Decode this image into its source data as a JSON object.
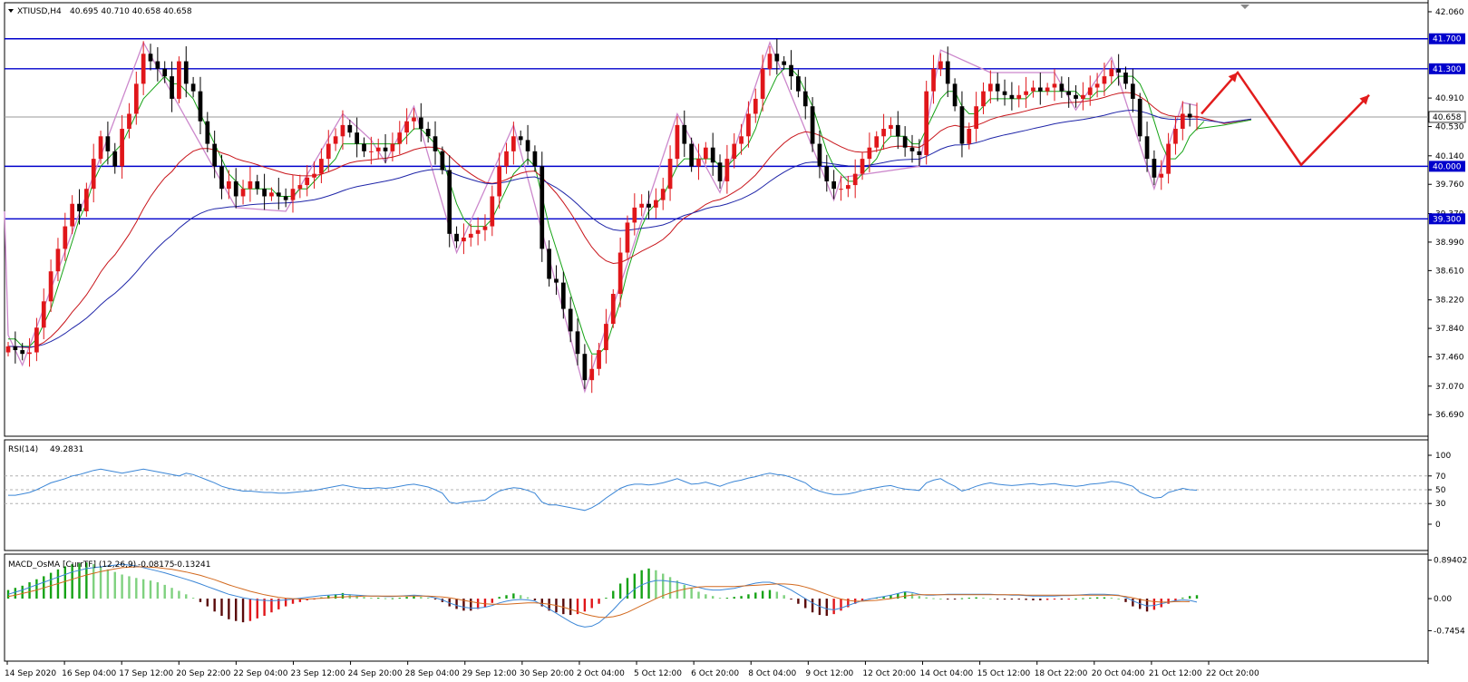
{
  "window": {
    "title": "XTIUSD,H4",
    "ohlc": "40.695 40.710 40.658 40.658"
  },
  "colors": {
    "bull": "#e0161a",
    "bear": "#000000",
    "level_line": "#0000cc",
    "ma_fast": "#16a316",
    "ma_mid": "#c8141a",
    "ma_slow": "#1f25a8",
    "zigzag": "#cc88cc",
    "forecast": "#e21c1c",
    "rsi": "#3b86d6",
    "macd_line": "#3b86d6",
    "signal_line": "#d2691e",
    "hist_up_strong": "#16a316",
    "hist_up_weak": "#7fd17f",
    "hist_down_strong": "#5a0b0b",
    "hist_down_weak": "#e0161a"
  },
  "chart_data": [
    {
      "type": "candlestick",
      "symbol": "XTIUSD",
      "timeframe": "H4",
      "ylim": [
        36.62,
        42.12
      ],
      "y_ticks": [
        "42.060",
        "41.700",
        "41.300",
        "40.910",
        "40.658",
        "40.530",
        "40.140",
        "40.000",
        "39.760",
        "39.370",
        "39.300",
        "38.990",
        "38.610",
        "38.220",
        "37.840",
        "37.460",
        "37.070",
        "36.690"
      ],
      "x_tick_labels": [
        "14 Sep 2020",
        "16 Sep 04:00",
        "17 Sep 12:00",
        "20 Sep 22:00",
        "22 Sep 04:00",
        "23 Sep 12:00",
        "24 Sep 20:00",
        "28 Sep 04:00",
        "29 Sep 12:00",
        "30 Sep 20:00",
        "2 Oct 04:00",
        "5 Oct 12:00",
        "6 Oct 20:00",
        "8 Oct 04:00",
        "9 Oct 12:00",
        "12 Oct 20:00",
        "14 Oct 04:00",
        "15 Oct 12:00",
        "18 Oct 22:00",
        "20 Oct 04:00",
        "21 Oct 12:00",
        "22 Oct 20:00"
      ],
      "levels": [
        {
          "label": "41.700",
          "value": 41.7
        },
        {
          "label": "41.300",
          "value": 41.3
        },
        {
          "label": "40.000",
          "value": 40.0
        },
        {
          "label": "39.300",
          "value": 39.3
        }
      ],
      "current_price": {
        "label": "40.658",
        "value": 40.658
      },
      "close": [
        37.6,
        37.55,
        37.5,
        37.52,
        37.85,
        38.2,
        38.6,
        38.9,
        39.2,
        39.5,
        39.4,
        39.7,
        40.1,
        40.4,
        40.2,
        40.0,
        40.5,
        40.7,
        41.1,
        41.5,
        41.4,
        41.3,
        41.2,
        40.9,
        41.4,
        41.1,
        41.0,
        40.6,
        40.3,
        40.0,
        39.7,
        39.8,
        39.6,
        39.7,
        39.8,
        39.7,
        39.6,
        39.65,
        39.6,
        39.55,
        39.7,
        39.75,
        39.85,
        39.9,
        40.1,
        40.3,
        40.4,
        40.55,
        40.45,
        40.3,
        40.2,
        40.2,
        40.25,
        40.2,
        40.3,
        40.45,
        40.6,
        40.65,
        40.5,
        40.4,
        40.2,
        39.95,
        39.1,
        39.0,
        39.05,
        39.1,
        39.15,
        39.2,
        39.6,
        40.0,
        40.2,
        40.4,
        40.35,
        40.2,
        40.0,
        38.9,
        38.5,
        38.45,
        38.1,
        37.8,
        37.5,
        37.15,
        37.3,
        37.55,
        37.9,
        38.3,
        38.85,
        39.25,
        39.45,
        39.5,
        39.45,
        39.55,
        39.7,
        40.1,
        40.55,
        40.3,
        40.0,
        40.1,
        40.25,
        40.05,
        39.8,
        40.1,
        40.3,
        40.4,
        40.7,
        40.9,
        41.3,
        41.5,
        41.4,
        41.35,
        41.2,
        41.0,
        40.8,
        40.3,
        40.0,
        39.8,
        39.7,
        39.7,
        39.75,
        39.9,
        40.1,
        40.25,
        40.4,
        40.5,
        40.55,
        40.4,
        40.25,
        40.2,
        40.15,
        41.0,
        41.3,
        41.4,
        41.1,
        40.8,
        40.3,
        40.5,
        40.8,
        41.0,
        41.1,
        41.0,
        40.95,
        40.9,
        40.95,
        41.0,
        41.05,
        41.0,
        41.05,
        41.1,
        41.0,
        40.95,
        40.9,
        40.95,
        41.05,
        41.1,
        41.2,
        41.3,
        41.25,
        41.1,
        40.9,
        40.4,
        40.1,
        39.85,
        39.9,
        40.3,
        40.5,
        40.7,
        40.65,
        40.66
      ],
      "ma_fast": [
        37.7,
        37.7,
        37.6,
        37.6,
        37.7,
        37.9,
        38.1,
        38.4,
        38.7,
        39.0,
        39.3,
        39.5,
        39.8,
        40.0,
        40.1,
        40.2,
        40.3,
        40.5,
        40.7,
        40.9,
        41.0,
        41.1,
        41.2,
        41.1,
        41.1,
        41.0,
        40.9,
        40.7,
        40.5,
        40.3,
        40.1,
        39.9,
        39.8,
        39.7,
        39.7,
        39.7,
        39.7,
        39.7,
        39.6,
        39.6,
        39.6,
        39.7,
        39.7,
        39.8,
        39.9,
        40.0,
        40.1,
        40.3,
        40.3,
        40.3,
        40.3,
        40.3,
        40.3,
        40.3,
        40.3,
        40.3,
        40.4,
        40.5,
        40.5,
        40.4,
        40.3,
        40.1,
        39.8,
        39.5,
        39.3,
        39.2,
        39.2,
        39.2,
        39.3,
        39.5,
        39.7,
        39.9,
        40.0,
        40.1,
        40.0,
        39.6,
        39.2,
        38.9,
        38.6,
        38.3,
        38.0,
        37.7,
        37.5,
        37.5,
        37.6,
        37.9,
        38.2,
        38.6,
        38.9,
        39.2,
        39.4,
        39.5,
        39.6,
        39.8,
        40.0,
        40.1,
        40.1,
        40.1,
        40.1,
        40.1,
        40.0,
        40.0,
        40.1,
        40.2,
        40.3,
        40.5,
        40.8,
        41.0,
        41.2,
        41.3,
        41.3,
        41.2,
        41.0,
        40.8,
        40.5,
        40.2,
        40.0,
        39.9,
        39.8,
        39.8,
        39.9,
        40.0,
        40.1,
        40.3,
        40.4,
        40.4,
        40.4,
        40.3,
        40.3,
        40.5,
        40.7,
        40.9,
        41.0,
        41.0,
        40.8,
        40.7,
        40.7,
        40.8,
        40.9,
        40.9,
        40.9,
        40.9,
        40.9,
        40.9,
        41.0,
        41.0,
        41.0,
        41.0,
        41.0,
        41.0,
        41.0,
        40.9,
        40.9,
        41.0,
        41.0,
        41.1,
        41.2,
        41.2,
        41.2,
        41.1,
        40.9,
        40.6,
        40.3,
        40.1,
        40.1,
        40.2,
        40.4,
        40.5,
        40.6
      ]
    },
    {
      "type": "line",
      "name": "RSI(14)",
      "value_label": "49.2831",
      "ylim": [
        0,
        100
      ],
      "y_ticks": [
        "100",
        "70",
        "50",
        "30",
        "0"
      ],
      "levels": [
        70,
        50,
        30
      ],
      "values": [
        42,
        42,
        44,
        46,
        50,
        55,
        60,
        63,
        66,
        70,
        72,
        75,
        78,
        80,
        78,
        76,
        74,
        76,
        78,
        80,
        78,
        76,
        74,
        72,
        70,
        74,
        72,
        68,
        64,
        60,
        55,
        52,
        50,
        48,
        48,
        47,
        46,
        46,
        45,
        45,
        46,
        47,
        48,
        49,
        51,
        53,
        55,
        57,
        55,
        53,
        52,
        52,
        53,
        52,
        53,
        55,
        57,
        58,
        56,
        54,
        50,
        45,
        32,
        30,
        32,
        33,
        34,
        35,
        42,
        48,
        51,
        53,
        52,
        49,
        45,
        32,
        28,
        28,
        26,
        24,
        22,
        20,
        24,
        30,
        38,
        45,
        52,
        56,
        58,
        58,
        57,
        58,
        60,
        63,
        66,
        62,
        58,
        59,
        61,
        58,
        55,
        59,
        62,
        64,
        67,
        69,
        72,
        74,
        72,
        71,
        68,
        64,
        60,
        52,
        48,
        45,
        43,
        43,
        44,
        46,
        49,
        51,
        53,
        55,
        56,
        53,
        51,
        50,
        49,
        60,
        64,
        66,
        60,
        55,
        48,
        51,
        55,
        58,
        60,
        58,
        57,
        56,
        57,
        58,
        59,
        57,
        58,
        59,
        57,
        56,
        55,
        56,
        58,
        59,
        60,
        62,
        61,
        58,
        55,
        46,
        42,
        38,
        39,
        46,
        49,
        52,
        50,
        49.28
      ]
    },
    {
      "type": "bar+line",
      "name": "MACD_OsMA [CurrTF] (12,26,9)",
      "value_labels": [
        "-0.08175",
        "-0.13241"
      ],
      "ylim": [
        -0.8,
        0.95
      ],
      "y_ticks": [
        "0.89402",
        "0.00",
        "-0.7454"
      ],
      "histogram": [
        0.2,
        0.25,
        0.3,
        0.38,
        0.45,
        0.52,
        0.6,
        0.68,
        0.75,
        0.8,
        0.82,
        0.84,
        0.8,
        0.75,
        0.68,
        0.62,
        0.56,
        0.52,
        0.48,
        0.45,
        0.42,
        0.38,
        0.32,
        0.25,
        0.18,
        0.1,
        0.02,
        -0.08,
        -0.18,
        -0.3,
        -0.4,
        -0.48,
        -0.52,
        -0.55,
        -0.52,
        -0.46,
        -0.4,
        -0.32,
        -0.25,
        -0.18,
        -0.12,
        -0.08,
        -0.04,
        -0.02,
        0.03,
        0.07,
        0.1,
        0.13,
        0.1,
        0.07,
        0.04,
        0.02,
        0.02,
        0.01,
        0.01,
        0.02,
        0.04,
        0.06,
        0.04,
        0.02,
        -0.02,
        -0.08,
        -0.18,
        -0.24,
        -0.28,
        -0.28,
        -0.24,
        -0.2,
        -0.1,
        0.04,
        0.08,
        0.12,
        0.08,
        0.03,
        -0.04,
        -0.18,
        -0.28,
        -0.32,
        -0.36,
        -0.38,
        -0.36,
        -0.3,
        -0.22,
        -0.12,
        0.02,
        0.18,
        0.35,
        0.48,
        0.58,
        0.66,
        0.7,
        0.66,
        0.58,
        0.5,
        0.42,
        0.32,
        0.24,
        0.16,
        0.1,
        0.06,
        0.02,
        0.02,
        0.04,
        0.06,
        0.1,
        0.14,
        0.18,
        0.2,
        0.16,
        0.08,
        -0.02,
        -0.12,
        -0.22,
        -0.32,
        -0.38,
        -0.4,
        -0.36,
        -0.28,
        -0.2,
        -0.12,
        -0.06,
        -0.02,
        0.02,
        0.05,
        0.08,
        0.12,
        0.16,
        0.12,
        0.06,
        0.03,
        0.01,
        0.0,
        -0.01,
        -0.01,
        0.01,
        0.02,
        0.03,
        0.02,
        0.0,
        -0.01,
        -0.01,
        -0.02,
        -0.02,
        -0.03,
        -0.04,
        -0.04,
        -0.03,
        -0.02,
        -0.02,
        -0.01,
        0.0,
        0.01,
        0.02,
        0.03,
        0.03,
        0.02,
        0.0,
        -0.08,
        -0.18,
        -0.24,
        -0.3,
        -0.26,
        -0.2,
        -0.12,
        -0.06,
        0.02,
        0.06,
        0.08
      ],
      "macd": [
        0.1,
        0.15,
        0.2,
        0.26,
        0.32,
        0.38,
        0.44,
        0.5,
        0.56,
        0.62,
        0.66,
        0.7,
        0.72,
        0.74,
        0.76,
        0.78,
        0.8,
        0.78,
        0.76,
        0.72,
        0.68,
        0.64,
        0.6,
        0.55,
        0.5,
        0.45,
        0.4,
        0.34,
        0.28,
        0.22,
        0.16,
        0.1,
        0.06,
        0.02,
        -0.01,
        -0.03,
        -0.04,
        -0.05,
        -0.04,
        -0.03,
        -0.01,
        0.01,
        0.03,
        0.05,
        0.07,
        0.08,
        0.09,
        0.1,
        0.09,
        0.08,
        0.07,
        0.06,
        0.06,
        0.05,
        0.05,
        0.06,
        0.07,
        0.08,
        0.07,
        0.05,
        0.02,
        -0.03,
        -0.1,
        -0.16,
        -0.2,
        -0.22,
        -0.22,
        -0.2,
        -0.16,
        -0.1,
        -0.06,
        -0.03,
        -0.02,
        -0.03,
        -0.06,
        -0.14,
        -0.24,
        -0.34,
        -0.44,
        -0.54,
        -0.62,
        -0.66,
        -0.64,
        -0.56,
        -0.42,
        -0.26,
        -0.08,
        0.08,
        0.22,
        0.32,
        0.38,
        0.42,
        0.42,
        0.4,
        0.38,
        0.34,
        0.3,
        0.26,
        0.22,
        0.2,
        0.2,
        0.22,
        0.24,
        0.28,
        0.32,
        0.36,
        0.38,
        0.38,
        0.34,
        0.28,
        0.2,
        0.1,
        0.0,
        -0.1,
        -0.18,
        -0.24,
        -0.26,
        -0.22,
        -0.16,
        -0.1,
        -0.05,
        -0.01,
        0.02,
        0.05,
        0.08,
        0.12,
        0.16,
        0.14,
        0.1,
        0.08,
        0.08,
        0.09,
        0.1,
        0.1,
        0.1,
        0.1,
        0.1,
        0.1,
        0.1,
        0.09,
        0.09,
        0.08,
        0.08,
        0.07,
        0.06,
        0.06,
        0.06,
        0.06,
        0.07,
        0.07,
        0.08,
        0.09,
        0.1,
        0.1,
        0.1,
        0.09,
        0.08,
        0.03,
        -0.05,
        -0.12,
        -0.17,
        -0.16,
        -0.12,
        -0.08,
        -0.05,
        -0.03,
        -0.04,
        -0.08
      ],
      "signal": [
        0.05,
        0.08,
        0.12,
        0.16,
        0.2,
        0.25,
        0.3,
        0.35,
        0.4,
        0.45,
        0.5,
        0.55,
        0.59,
        0.63,
        0.66,
        0.69,
        0.72,
        0.73,
        0.74,
        0.74,
        0.73,
        0.72,
        0.7,
        0.68,
        0.65,
        0.62,
        0.58,
        0.54,
        0.49,
        0.44,
        0.38,
        0.32,
        0.27,
        0.22,
        0.17,
        0.13,
        0.09,
        0.06,
        0.03,
        0.01,
        0.0,
        -0.01,
        -0.01,
        0.0,
        0.01,
        0.02,
        0.03,
        0.04,
        0.05,
        0.05,
        0.06,
        0.06,
        0.06,
        0.06,
        0.06,
        0.06,
        0.06,
        0.06,
        0.06,
        0.06,
        0.05,
        0.04,
        0.02,
        -0.01,
        -0.04,
        -0.07,
        -0.1,
        -0.12,
        -0.13,
        -0.13,
        -0.13,
        -0.12,
        -0.11,
        -0.1,
        -0.1,
        -0.11,
        -0.13,
        -0.16,
        -0.2,
        -0.25,
        -0.3,
        -0.36,
        -0.4,
        -0.43,
        -0.44,
        -0.42,
        -0.38,
        -0.32,
        -0.24,
        -0.16,
        -0.08,
        0.0,
        0.07,
        0.13,
        0.18,
        0.22,
        0.25,
        0.27,
        0.28,
        0.28,
        0.28,
        0.28,
        0.28,
        0.29,
        0.3,
        0.31,
        0.32,
        0.33,
        0.34,
        0.34,
        0.33,
        0.31,
        0.27,
        0.22,
        0.16,
        0.1,
        0.04,
        -0.01,
        -0.04,
        -0.06,
        -0.06,
        -0.05,
        -0.04,
        -0.02,
        0.0,
        0.03,
        0.06,
        0.08,
        0.09,
        0.09,
        0.09,
        0.09,
        0.09,
        0.09,
        0.09,
        0.09,
        0.09,
        0.09,
        0.09,
        0.09,
        0.09,
        0.09,
        0.09,
        0.08,
        0.08,
        0.08,
        0.08,
        0.08,
        0.08,
        0.08,
        0.08,
        0.08,
        0.08,
        0.08,
        0.08,
        0.08,
        0.07,
        0.05,
        0.02,
        -0.02,
        -0.05,
        -0.07,
        -0.08,
        -0.08,
        -0.07,
        -0.07,
        -0.07
      ]
    }
  ]
}
